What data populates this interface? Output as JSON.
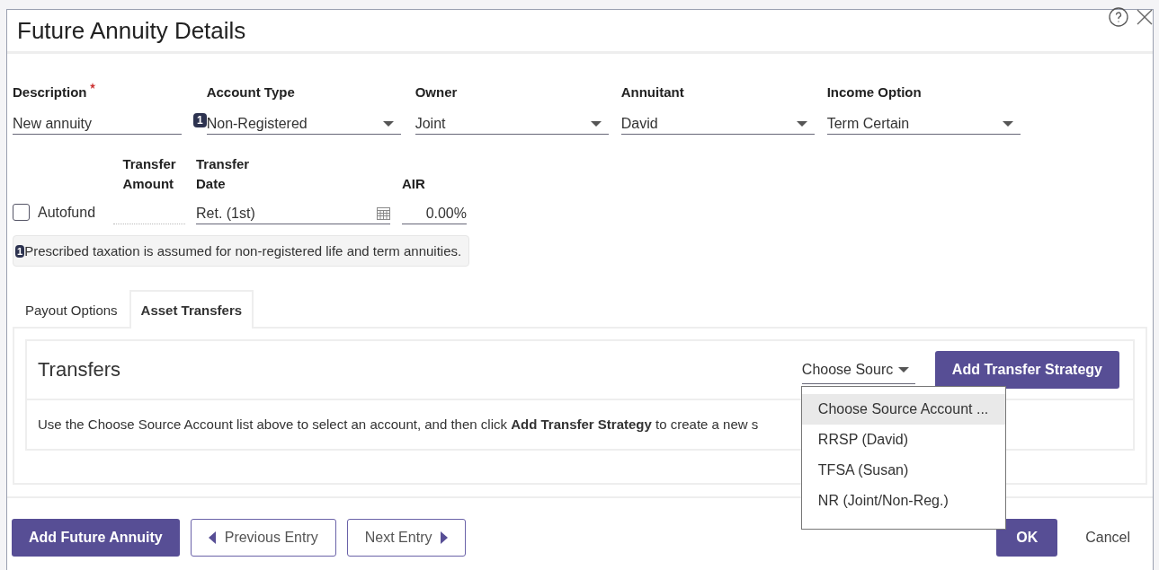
{
  "window": {
    "title": "Future Annuity Details"
  },
  "fields": [
    {
      "label": "Description",
      "required": true,
      "value": "New annuity",
      "kind": "text"
    },
    {
      "label": "Account Type",
      "required": false,
      "value": "Non-Registered",
      "kind": "select",
      "badge": "1"
    },
    {
      "label": "Owner",
      "required": false,
      "value": "Joint",
      "kind": "select"
    },
    {
      "label": "Annuitant",
      "required": false,
      "value": "David",
      "kind": "select"
    },
    {
      "label": "Income Option",
      "required": false,
      "value": "Term Certain",
      "kind": "select"
    }
  ],
  "autofund": {
    "label": "Autofund",
    "checked": false
  },
  "transfer_amount": {
    "label": [
      "Transfer",
      "Amount"
    ]
  },
  "transfer_date": {
    "label": [
      "Transfer",
      "Date"
    ],
    "value": "Ret. (1st)"
  },
  "air": {
    "label": "AIR",
    "value": "0.00%"
  },
  "note": {
    "badge": "1",
    "text": "Prescribed taxation is assumed for non-registered life and term annuities."
  },
  "tabs": [
    {
      "label": "Payout Options",
      "selected": false
    },
    {
      "label": "Asset Transfers",
      "selected": true
    }
  ],
  "transfers": {
    "title": "Transfers",
    "source_select": "Choose Sourc",
    "add_button": "Add Transfer Strategy",
    "instructions": "Use the Choose Source Account list above to select an account, and then click **Add Transfer Strategy** to create a new s",
    "dropdown": [
      {
        "label": "Choose Source Account ...",
        "selected": true
      },
      {
        "label": "RRSP (David)",
        "selected": false
      },
      {
        "label": "TFSA (Susan)",
        "selected": false
      },
      {
        "label": "NR (Joint/Non-Reg.)",
        "selected": false
      }
    ]
  },
  "footer": {
    "add": "Add Future Annuity",
    "previous": "Previous Entry",
    "next": "Next Entry",
    "ok": "OK",
    "cancel": "Cancel"
  }
}
